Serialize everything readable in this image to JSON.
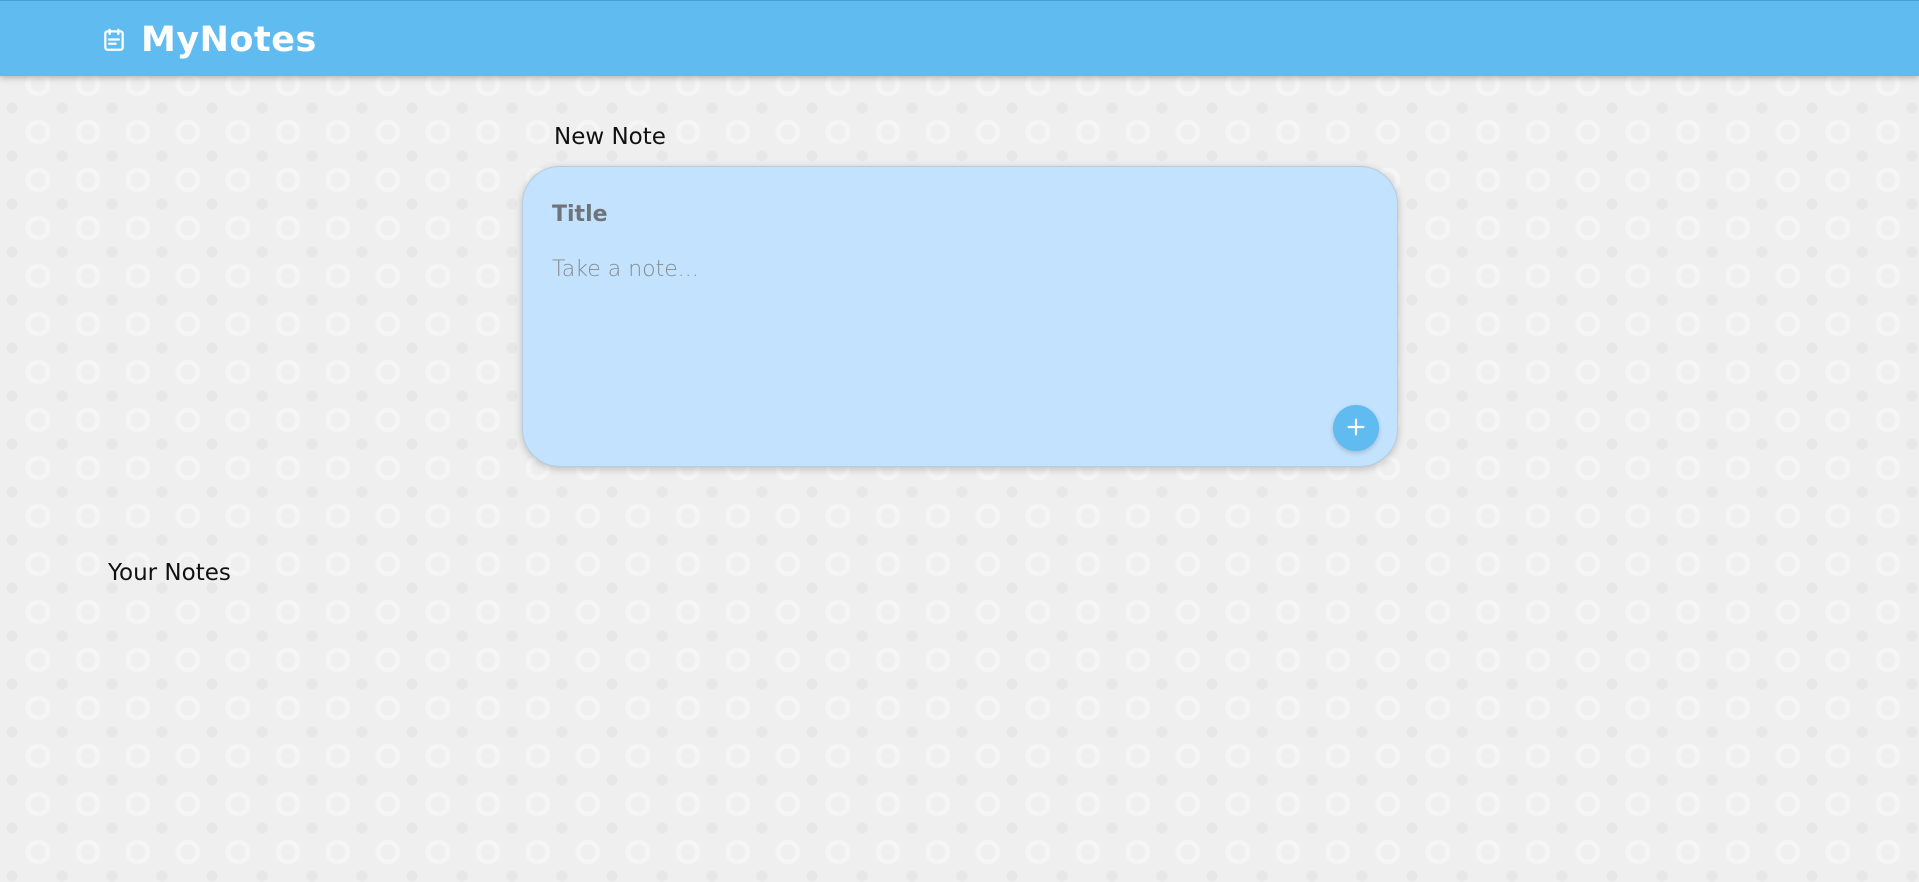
{
  "header": {
    "app_title": "MyNotes",
    "icon": "notes-calendar-icon",
    "background_color": "#5fbbf0"
  },
  "new_note": {
    "heading": "New Note",
    "title_placeholder": "Title",
    "body_placeholder": "Take a note...",
    "add_icon": "plus-icon",
    "card_color": "#c3e2fd"
  },
  "notes_section": {
    "heading": "Your Notes",
    "items": []
  }
}
